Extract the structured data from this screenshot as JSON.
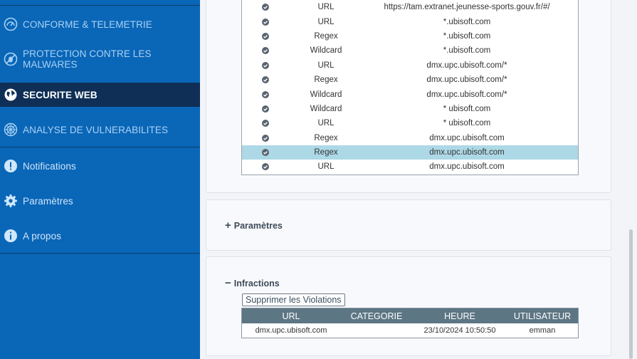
{
  "sidebar": {
    "items": [
      {
        "label": "CONFORME & TELEMETRIE",
        "icon": "gauge-icon"
      },
      {
        "label": "PROTECTION CONTRE LES MALWARES",
        "icon": "malware-icon"
      },
      {
        "label": "SECURITE WEB",
        "icon": "globe-icon"
      },
      {
        "label": "ANALYSE DE VULNERABILITES",
        "icon": "vulnerability-icon"
      },
      {
        "label": "Notifications",
        "icon": "alert-icon"
      },
      {
        "label": "Paramètres",
        "icon": "gear-icon"
      },
      {
        "label": "A propos",
        "icon": "info-icon"
      }
    ]
  },
  "rules": {
    "rows": [
      {
        "type": "URL",
        "value": "https://tam.extranet.jeunesse-sports.gouv.fr/#/"
      },
      {
        "type": "URL",
        "value": "*.ubisoft.com"
      },
      {
        "type": "Regex",
        "value": "*.ubisoft.com"
      },
      {
        "type": "Wildcard",
        "value": "*.ubisoft.com"
      },
      {
        "type": "URL",
        "value": "dmx.upc.ubisoft.com/*"
      },
      {
        "type": "Regex",
        "value": "dmx.upc.ubisoft.com/*"
      },
      {
        "type": "Wildcard",
        "value": "dmx.upc.ubisoft.com/*"
      },
      {
        "type": "Wildcard",
        "value": "* ubisoft.com"
      },
      {
        "type": "URL",
        "value": "* ubisoft.com"
      },
      {
        "type": "Regex",
        "value": "dmx.upc.ubisoft.com"
      },
      {
        "type": "Regex",
        "value": "dmx.upc.ubisoft.com"
      },
      {
        "type": "URL",
        "value": "dmx.upc.ubisoft.com"
      }
    ]
  },
  "parametres": {
    "label": "Paramètres",
    "symbol": "+"
  },
  "infractions": {
    "label": "Infractions",
    "symbol": "−",
    "delete_button": "Supprimer les Violations",
    "headers": {
      "url": "URL",
      "categorie": "CATEGORIE",
      "heure": "HEURE",
      "utilisateur": "UTILISATEUR"
    },
    "rows": [
      {
        "url": "dmx.upc.ubisoft.com",
        "categorie": "",
        "heure": "23/10/2024 10:50:50",
        "utilisateur": "emman"
      }
    ]
  },
  "colors": {
    "sidebar": "#0a66b7",
    "sidebar_active": "#0f2f56",
    "selected_row": "#add8e6",
    "table_header": "#5d7684"
  }
}
